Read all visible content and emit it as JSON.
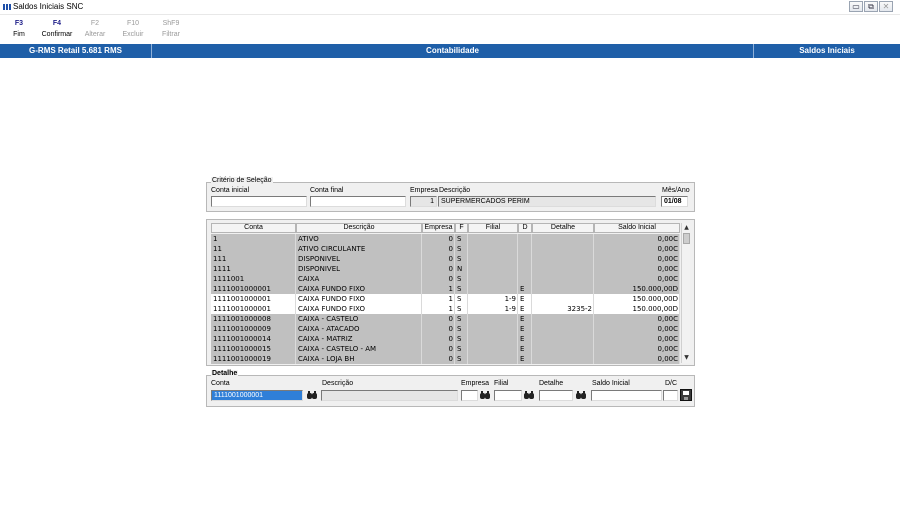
{
  "window": {
    "title": "Saldos Iniciais SNC",
    "buttons": {
      "minimize": "▭",
      "restore": "⧉",
      "close": "✕"
    }
  },
  "toolbar": [
    {
      "key": "F3",
      "label": "Fim",
      "enabled": true
    },
    {
      "key": "F4",
      "label": "Confirmar",
      "enabled": true
    },
    {
      "key": "F2",
      "label": "Alterar",
      "enabled": false
    },
    {
      "key": "F10",
      "label": "Excluir",
      "enabled": false
    },
    {
      "key": "ShF9",
      "label": "Filtrar",
      "enabled": false
    }
  ],
  "header_bar": {
    "system": "G-RMS Retail 5.681 RMS",
    "module": "Contabilidade",
    "screen": "Saldos Iniciais",
    "color": "#1f5fa8"
  },
  "criteria": {
    "legend": "Critério de Seleção",
    "conta_inicial_label": "Conta inicial",
    "conta_inicial_value": "",
    "conta_final_label": "Conta final",
    "conta_final_value": "",
    "empresa_label": "Empresa",
    "empresa_value": "1",
    "descricao_label": "Descrição",
    "descricao_value": "SUPERMERCADOS PERIM",
    "mes_ano_label": "Mês/Ano",
    "mes_ano_value": "01/08"
  },
  "grid": {
    "columns": [
      "Conta",
      "Descrição",
      "Empresa",
      "F",
      "Filial",
      "D",
      "Detalhe",
      "Saldo Inicial"
    ],
    "rows": [
      {
        "conta": "1",
        "descricao": "ATIVO",
        "empresa": "0",
        "f": "S",
        "filial": "",
        "d": "",
        "detalhe": "",
        "saldo": "0,00C",
        "style": "grey"
      },
      {
        "conta": "11",
        "descricao": "ATIVO CIRCULANTE",
        "empresa": "0",
        "f": "S",
        "filial": "",
        "d": "",
        "detalhe": "",
        "saldo": "0,00C",
        "style": "grey"
      },
      {
        "conta": "111",
        "descricao": "DISPONIVEL",
        "empresa": "0",
        "f": "S",
        "filial": "",
        "d": "",
        "detalhe": "",
        "saldo": "0,00C",
        "style": "grey"
      },
      {
        "conta": "1111",
        "descricao": "DISPONIVEL",
        "empresa": "0",
        "f": "N",
        "filial": "",
        "d": "",
        "detalhe": "",
        "saldo": "0,00C",
        "style": "grey"
      },
      {
        "conta": "1111001",
        "descricao": "CAIXA",
        "empresa": "0",
        "f": "S",
        "filial": "",
        "d": "",
        "detalhe": "",
        "saldo": "0,00C",
        "style": "grey"
      },
      {
        "conta": "1111001000001",
        "descricao": "CAIXA FUNDO FIXO",
        "empresa": "1",
        "f": "S",
        "filial": "",
        "d": "E",
        "detalhe": "",
        "saldo": "150.000,00D",
        "style": "grey"
      },
      {
        "conta": "1111001000001",
        "descricao": "CAIXA FUNDO FIXO",
        "empresa": "1",
        "f": "S",
        "filial": "1-9",
        "d": "E",
        "detalhe": "",
        "saldo": "150.000,00D",
        "style": "white"
      },
      {
        "conta": "1111001000001",
        "descricao": "CAIXA FUNDO FIXO",
        "empresa": "1",
        "f": "S",
        "filial": "1-9",
        "d": "E",
        "detalhe": "3235-2",
        "saldo": "150.000,00D",
        "style": "white"
      },
      {
        "conta": "1111001000008",
        "descricao": "CAIXA - CASTELO",
        "empresa": "0",
        "f": "S",
        "filial": "",
        "d": "E",
        "detalhe": "",
        "saldo": "0,00C",
        "style": "grey"
      },
      {
        "conta": "1111001000009",
        "descricao": "CAIXA - ATACADO",
        "empresa": "0",
        "f": "S",
        "filial": "",
        "d": "E",
        "detalhe": "",
        "saldo": "0,00C",
        "style": "grey"
      },
      {
        "conta": "1111001000014",
        "descricao": "CAIXA - MATRIZ",
        "empresa": "0",
        "f": "S",
        "filial": "",
        "d": "E",
        "detalhe": "",
        "saldo": "0,00C",
        "style": "grey"
      },
      {
        "conta": "1111001000015",
        "descricao": "CAIXA - CASTELO - AM",
        "empresa": "0",
        "f": "S",
        "filial": "",
        "d": "E",
        "detalhe": "",
        "saldo": "0,00C",
        "style": "grey"
      },
      {
        "conta": "1111001000019",
        "descricao": "CAIXA - LOJA BH",
        "empresa": "0",
        "f": "S",
        "filial": "",
        "d": "E",
        "detalhe": "",
        "saldo": "0,00C",
        "style": "grey"
      }
    ]
  },
  "scrollbar": {
    "up": "▲",
    "down": "▼"
  },
  "detail": {
    "legend": "Detalhe",
    "conta_label": "Conta",
    "conta_value": "1111001000001",
    "descricao_label": "Descrição",
    "descricao_value": "",
    "empresa_label": "Empresa",
    "empresa_value": "",
    "filial_label": "Filial",
    "filial_value": "",
    "detalhe_label": "Detalhe",
    "detalhe_value": "",
    "saldo_label": "Saldo Inicial",
    "saldo_value": "",
    "dc_label": "D/C",
    "dc_value": ""
  },
  "icons": {
    "app": "app-icon",
    "search": "binoculars-icon",
    "save": "floppy-disk-icon"
  }
}
